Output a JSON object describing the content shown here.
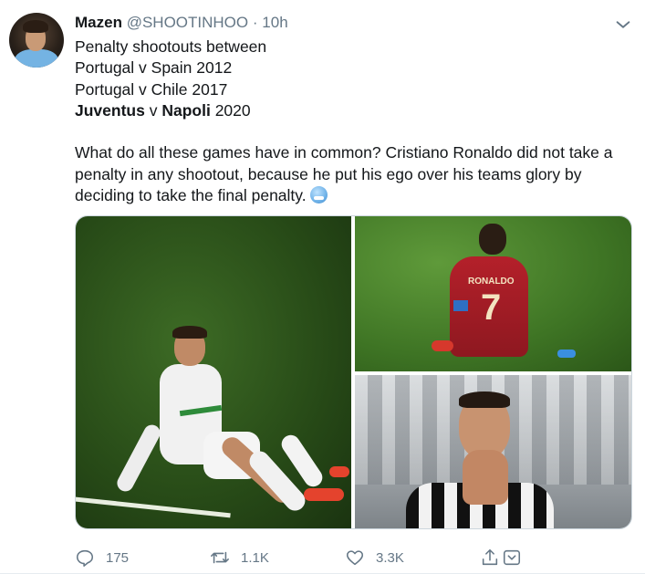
{
  "author": {
    "name": "Mazen",
    "handle": "@SHOOTINHOO",
    "separator": "·",
    "time": "10h"
  },
  "tweet": {
    "lines": [
      "Penalty shootouts between",
      "Portugal v Spain 2012",
      "Portugal v Chile 2017"
    ],
    "line4": {
      "team1": "Juventus",
      "v": "v",
      "team2": "Napoli",
      "year": "2020"
    },
    "paragraph": [
      "What do all these games have in common? Cristiano Ronaldo did not take a",
      "penalty in any shootout, because he put his ego over his teams glory by",
      "deciding to take the final penalty."
    ],
    "emoji": "grimacing-face-emoji"
  },
  "media": {
    "photos": [
      {
        "description": "player-sitting-on-pitch-white-kit"
      },
      {
        "description": "player-sitting-red-kit-number-7",
        "jersey_name": "RONALDO",
        "jersey_number": "7"
      },
      {
        "description": "player-hands-on-face-striped-kit"
      }
    ]
  },
  "actions": {
    "reply_count": "175",
    "retweet_count": "1.1K",
    "like_count": "3.3K"
  },
  "colors": {
    "text": "#14171a",
    "secondary": "#657786",
    "border": "#e6ecf0"
  }
}
